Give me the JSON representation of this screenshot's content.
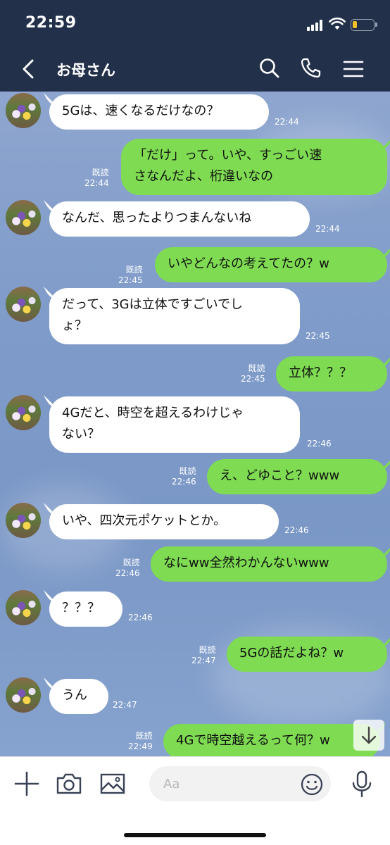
{
  "status": {
    "time": "22:59",
    "battery_level": 0.2
  },
  "header": {
    "back_icon": "chevron-left-icon",
    "title": "お母さん",
    "icons": [
      "search-icon",
      "phone-icon",
      "menu-icon"
    ]
  },
  "colors": {
    "header_bg": "#22304a",
    "sent_bubble": "#7edb52",
    "received_bubble": "#ffffff",
    "battery": "#f2c029"
  },
  "messages": [
    {
      "from": "them",
      "text": "5Gは、速くなるだけなの？",
      "time": "22:44"
    },
    {
      "from": "me",
      "text": "「だけ」って。いや、すっごい速\nさなんだよ、桁違いなの",
      "read": "既読",
      "time": "22:44"
    },
    {
      "from": "them",
      "text": "なんだ、思ったよりつまんないね",
      "time": "22:44"
    },
    {
      "from": "me",
      "text": "いやどんなの考えてたの？w",
      "read": "既読",
      "time": "22:45"
    },
    {
      "from": "them",
      "text": "だって、3Gは立体ですごいでし\nょ？",
      "time": "22:45"
    },
    {
      "from": "me",
      "text": "立体？？？",
      "read": "既読",
      "time": "22:45"
    },
    {
      "from": "them",
      "text": "4Gだと、時空を超えるわけじゃ\nない？",
      "time": "22:46"
    },
    {
      "from": "me",
      "text": "え、どゆこと？www",
      "read": "既読",
      "time": "22:46"
    },
    {
      "from": "them",
      "text": "いや、四次元ポケットとか。",
      "time": "22:46"
    },
    {
      "from": "me",
      "text": "なにww全然わかんないwww",
      "read": "既読",
      "time": "22:46"
    },
    {
      "from": "them",
      "text": "？？？",
      "time": "22:46"
    },
    {
      "from": "me",
      "text": "5Gの話だよね？w",
      "read": "既読",
      "time": "22:47"
    },
    {
      "from": "them",
      "text": "うん",
      "time": "22:47"
    },
    {
      "from": "me",
      "text": "4Gで時空越えるって何？w",
      "read": "既読",
      "time": "22:49"
    }
  ],
  "composer": {
    "placeholder": "Aa",
    "icons": [
      "plus-icon",
      "camera-icon",
      "image-icon",
      "emoji-icon",
      "microphone-icon",
      "arrow-down-icon"
    ]
  }
}
